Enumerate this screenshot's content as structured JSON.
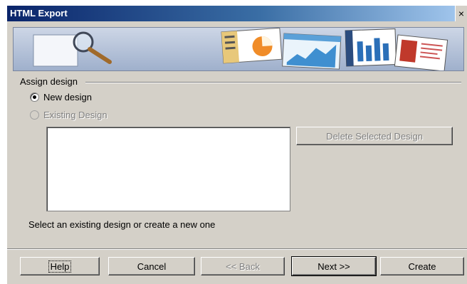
{
  "window": {
    "title": "HTML Export",
    "close_glyph": "×"
  },
  "banner": {
    "icons": [
      "magnifier-icon",
      "presentation-thumbnails-icon"
    ]
  },
  "assign_design": {
    "group_label": "Assign design",
    "new_design_label": "New design",
    "new_design_checked": true,
    "existing_design_label": "Existing Design",
    "existing_design_enabled": false,
    "designs": [],
    "delete_button_label": "Delete Selected Design"
  },
  "hint": "Select an existing design or create a new one",
  "footer": {
    "help_label": "Help",
    "cancel_label": "Cancel",
    "back_label": "<< Back",
    "next_label": "Next >>",
    "create_label": "Create"
  },
  "colors": {
    "dialog_bg": "#d4d0c8",
    "titlebar_start": "#0a246a",
    "titlebar_end": "#a6caf0",
    "disabled_text": "#808080"
  }
}
